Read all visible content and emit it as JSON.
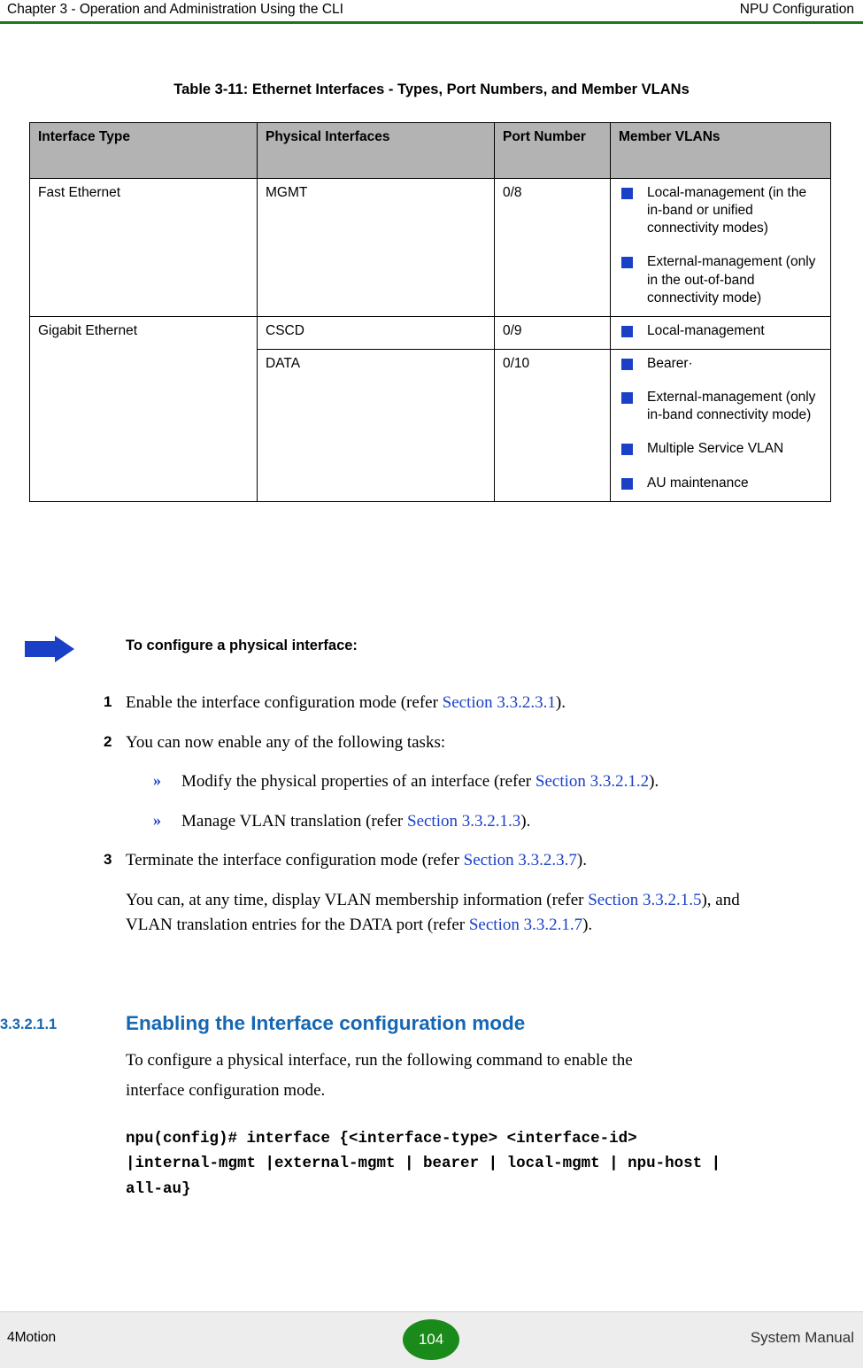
{
  "header": {
    "left": "Chapter 3 - Operation and Administration Using the CLI",
    "right": "NPU Configuration",
    "rule_color": "#1a7a1a"
  },
  "table": {
    "caption": "Table 3-11: Ethernet Interfaces - Types, Port Numbers, and Member VLANs",
    "columns": [
      "Interface Type",
      "Physical Interfaces",
      "Port Number",
      "Member VLANs"
    ],
    "rows": [
      {
        "interface_type": "Fast Ethernet",
        "physical_interface": "MGMT",
        "port_number": "0/8",
        "member_vlans": [
          "Local-management (in the in-band or unified connectivity modes)",
          "External-management (only in the out-of-band connectivity mode)"
        ]
      },
      {
        "interface_type": "Gigabit Ethernet",
        "physical_interface": "CSCD",
        "port_number": "0/9",
        "member_vlans": [
          "Local-management"
        ]
      },
      {
        "interface_type": "",
        "physical_interface": "DATA",
        "port_number": "0/10",
        "member_vlans": [
          "Bearer·",
          "External-management (only in-band connectivity mode)",
          "Multiple Service VLAN",
          "AU maintenance"
        ]
      }
    ],
    "header_bg": "#b3b3b3",
    "bullet_color": "#1a40c8"
  },
  "note": {
    "title": "To configure a physical interface:",
    "arrow_color": "#1a40c8"
  },
  "procedure": {
    "steps": [
      {
        "num": "1",
        "text_before": "Enable the interface configuration mode (refer ",
        "link": "Section 3.3.2.3.1",
        "text_after": ")."
      },
      {
        "num": "2",
        "text_before": "You can now enable any of the following tasks:",
        "link": "",
        "text_after": ""
      }
    ],
    "substeps": [
      {
        "chev": "»",
        "text_before": "Modify the physical properties of an interface (refer ",
        "link": "Section 3.3.2.1.2",
        "text_after": ")."
      },
      {
        "chev": "»",
        "text_before": "Manage VLAN translation (refer ",
        "link": "Section 3.3.2.1.3",
        "text_after": ")."
      }
    ],
    "step3": {
      "num": "3",
      "text_before": "Terminate the interface configuration mode (refer ",
      "link": "Section 3.3.2.3.7",
      "text_after": ")."
    },
    "closing": {
      "part1": "You can, at any time, display VLAN membership information (refer ",
      "link1": "Section 3.3.2.1.5",
      "part2": "), and VLAN translation entries for the DATA port (refer ",
      "link2": "Section 3.3.2.1.7",
      "part3": ")."
    }
  },
  "section": {
    "number": "3.3.2.1.1",
    "title": "Enabling the Interface configuration mode",
    "color": "#1667b3",
    "body_line1": "To configure a physical interface, run the following command to enable the",
    "body_line2": "interface configuration mode."
  },
  "code": {
    "line1": "npu(config)# interface {<interface-type> <interface-id>",
    "line2": "|internal-mgmt |external-mgmt | bearer | local-mgmt | npu-host |",
    "line3": "all-au}"
  },
  "footer": {
    "left": "4Motion",
    "page": "104",
    "right": "System Manual",
    "page_badge_color": "#1a8a1a"
  }
}
